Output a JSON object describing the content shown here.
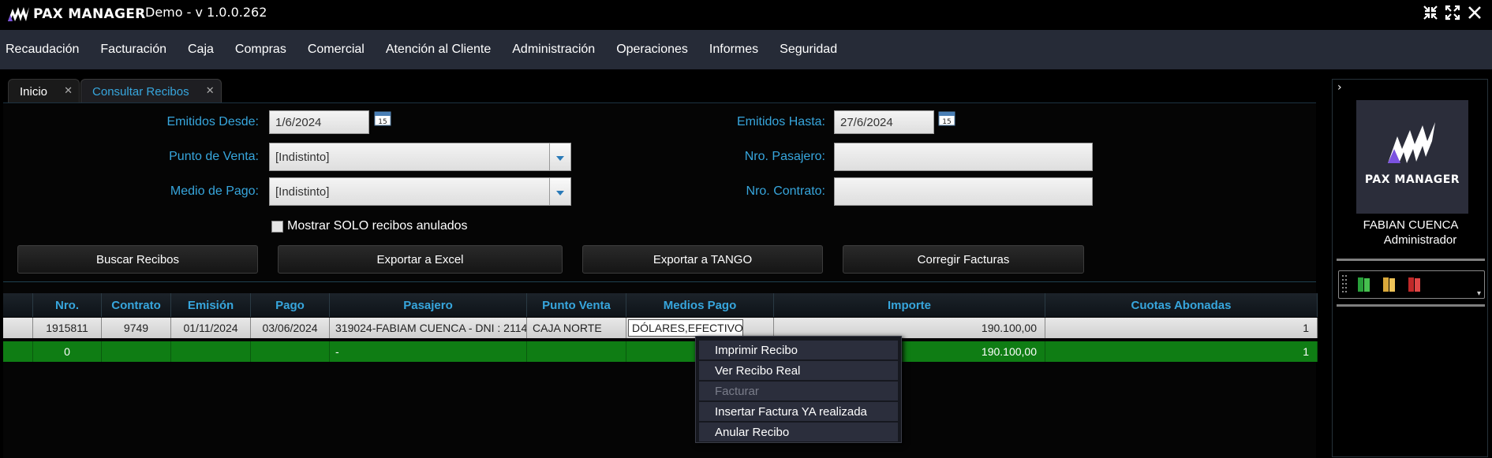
{
  "app": {
    "logo_text": "PAX MANAGER",
    "title": "Demo - v 1.0.0.262"
  },
  "menu": [
    "Recaudación",
    "Facturación",
    "Caja",
    "Compras",
    "Comercial",
    "Atención al Cliente",
    "Administración",
    "Operaciones",
    "Informes",
    "Seguridad"
  ],
  "tabs": [
    {
      "label": "Inicio",
      "close": "✕"
    },
    {
      "label": "Consultar Recibos",
      "close": "✕"
    }
  ],
  "filters": {
    "desde_label": "Emitidos Desde:",
    "desde_value": "1/6/2024",
    "hasta_label": "Emitidos Hasta:",
    "hasta_value": "27/6/2024",
    "punto_label": "Punto de Venta:",
    "punto_value": "[Indistinto]",
    "medio_label": "Medio de Pago:",
    "medio_value": "[Indistinto]",
    "pasajero_label": "Nro. Pasajero:",
    "pasajero_value": "",
    "contrato_label": "Nro. Contrato:",
    "contrato_value": "",
    "anulados_label": "Mostrar SOLO recibos anulados",
    "calendar_day": "15"
  },
  "buttons": {
    "buscar": "Buscar Recibos",
    "excel": "Exportar a Excel",
    "tango": "Exportar a TANGO",
    "corregir": "Corregir Facturas"
  },
  "grid": {
    "columns": [
      "Nro.",
      "Contrato",
      "Emisión",
      "Pago",
      "Pasajero",
      "Punto Venta",
      "Medios Pago",
      "Importe",
      "Cuotas Abonadas"
    ],
    "rows": [
      [
        "1915811",
        "9749",
        "01/11/2024",
        "03/06/2024",
        "319024-FABIAM CUENCA - DNI : 2114",
        "CAJA NORTE",
        "DÓLARES,EFECTIVO",
        "190.100,00",
        "1"
      ]
    ],
    "totals": [
      "0",
      "",
      "",
      "",
      "-",
      "",
      "",
      "190.100,00",
      "1"
    ]
  },
  "context_menu": [
    {
      "label": "Imprimir Recibo",
      "enabled": true
    },
    {
      "label": "Ver Recibo Real",
      "enabled": true
    },
    {
      "label": "Facturar",
      "enabled": false
    },
    {
      "label": "Insertar Factura YA realizada",
      "enabled": true
    },
    {
      "label": "Anular Recibo",
      "enabled": true
    }
  ],
  "sidebar": {
    "toggle": "›",
    "avatar_text": "PAX MANAGER",
    "user_name": "FABIAN CUENCA",
    "user_role": "Administrador",
    "dropdown_arrow": "▾"
  },
  "colors": {
    "accent_blue": "#37a6dd",
    "menubar": "#262b37",
    "totals_green": "#0f7d14",
    "brand_purple": "#7b52e0"
  }
}
